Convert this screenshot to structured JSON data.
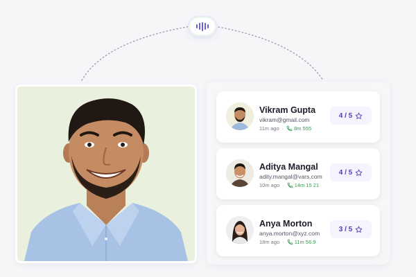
{
  "colors": {
    "accent": "#6b5fd8",
    "rating_text": "#4a3fb8",
    "duration_green": "#2f9a4f",
    "photo_background": "#eaf0de"
  },
  "voice_indicator": {
    "icon": "voice-waveform-icon"
  },
  "candidates": [
    {
      "name": "Vikram Gupta",
      "email": "vikram@gmail.com",
      "time_ago": "11m ago",
      "duration": "8m 555",
      "rating": "4 / 5",
      "rating_icon": "star-icon"
    },
    {
      "name": "Aditya Mangal",
      "email": "adity.mangal@vars.com",
      "time_ago": "10m ago",
      "duration": "14m 15 21",
      "rating": "4 / 5",
      "rating_icon": "star-icon"
    },
    {
      "name": "Anya Morton",
      "email": "anya.morton@xyz.com",
      "time_ago": "18m ago",
      "duration": "11m 56.9",
      "rating": "3 / 5",
      "rating_icon": "star-icon"
    }
  ]
}
